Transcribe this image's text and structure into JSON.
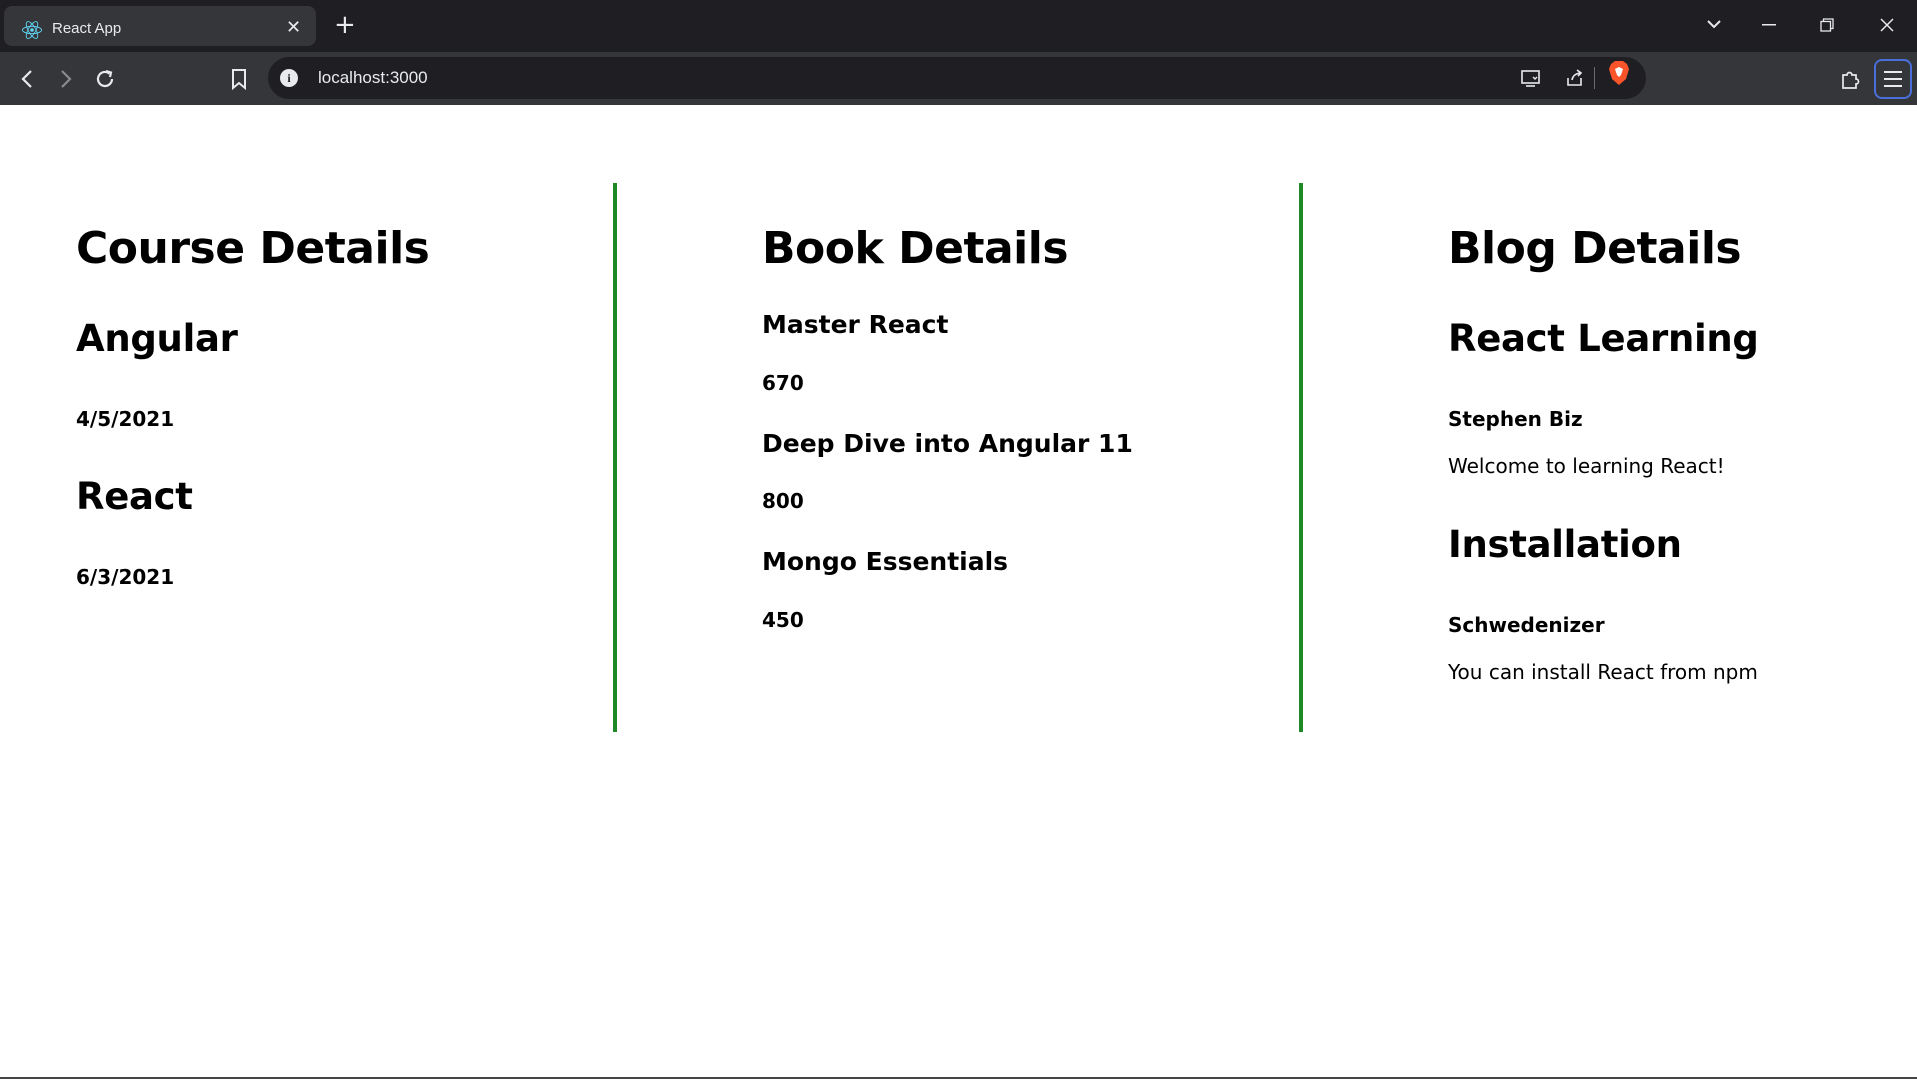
{
  "browser": {
    "tab_title": "React App",
    "tab_close": "✕",
    "new_tab": "+",
    "address": "localhost:3000",
    "info_glyph": "i"
  },
  "course": {
    "heading": "Course Details",
    "items": [
      {
        "name": "Angular",
        "date": "4/5/2021"
      },
      {
        "name": "React",
        "date": "6/3/2021"
      }
    ]
  },
  "book": {
    "heading": "Book Details",
    "items": [
      {
        "name": "Master React",
        "price": "670"
      },
      {
        "name": "Deep Dive into Angular 11",
        "price": "800"
      },
      {
        "name": "Mongo Essentials",
        "price": "450"
      }
    ]
  },
  "blog": {
    "heading": "Blog Details",
    "items": [
      {
        "title": "React Learning",
        "author": "Stephen Biz",
        "content": "Welcome to learning React!"
      },
      {
        "title": "Installation",
        "author": "Schwedenizer",
        "content": "You can install React from npm"
      }
    ]
  },
  "colors": {
    "divider": "#1f8a25",
    "chrome_dark": "#1f1f23",
    "chrome_mid": "#35363a",
    "chrome_text": "#e8eaed"
  }
}
